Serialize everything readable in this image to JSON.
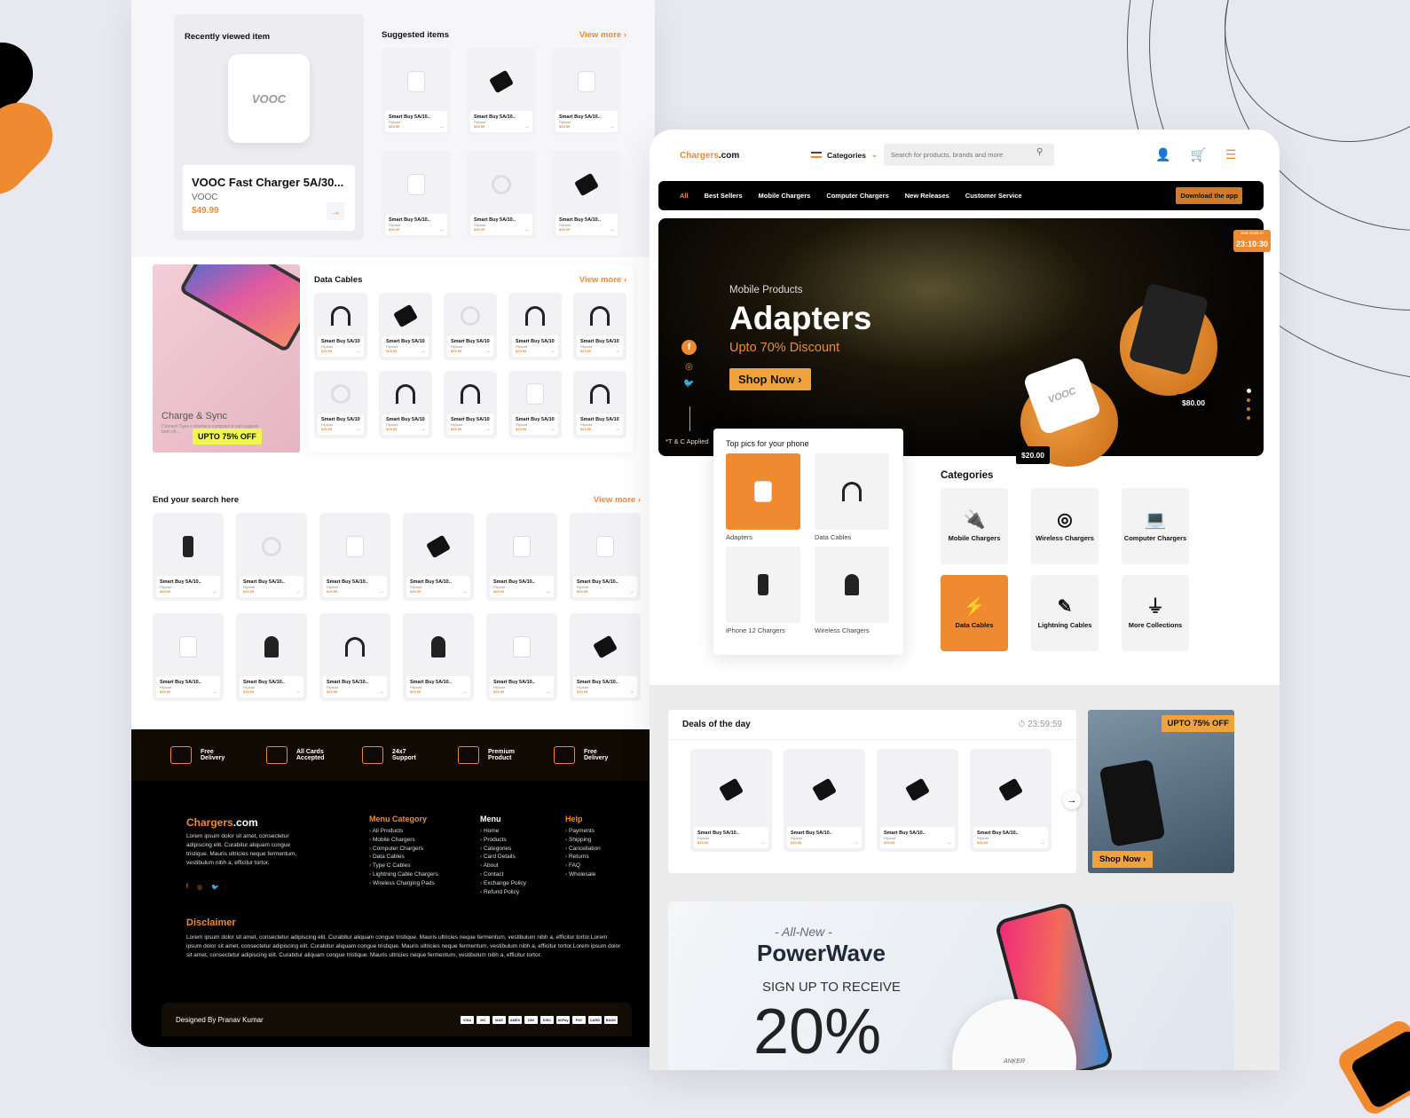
{
  "left_page": {
    "recent": {
      "heading": "Recently viewed item",
      "image_label": "VOOC",
      "product_name": "VOOC Fast Charger 5A/30...",
      "brand": "VOOC",
      "price": "$49.99",
      "arrow": "→"
    },
    "suggested": {
      "heading": "Suggested items",
      "view_more": "View more ›",
      "items": [
        {
          "name": "Smart Buy 5A/10..",
          "store": "Flipkart",
          "price": "$29.99",
          "shape": "charger-w"
        },
        {
          "name": "Smart Buy 5A/10..",
          "store": "Flipkart",
          "price": "$29.99",
          "shape": "charger-b"
        },
        {
          "name": "Smart Buy 5A/10..",
          "store": "Flipkart",
          "price": "$29.99",
          "shape": "charger-w"
        },
        {
          "name": "Smart Buy 5A/10..",
          "store": "Flipkart",
          "price": "$29.99",
          "shape": "charger-w"
        },
        {
          "name": "Smart Buy 5A/10..",
          "store": "Flipkart",
          "price": "$29.99",
          "shape": "coil"
        },
        {
          "name": "Smart Buy 5A/10..",
          "store": "Flipkart",
          "price": "$29.99",
          "shape": "charger-b"
        }
      ]
    },
    "promo_pink": {
      "title": "Charge & Sync",
      "desc": "Connect Type-c interface computer,it can support both ch...",
      "badge": "UPTO 75% OFF"
    },
    "data_cables": {
      "heading": "Data Cables",
      "view_more": "View more ›",
      "items": [
        {
          "name": "Smart Buy 5A/10..",
          "store": "Flipkart",
          "price": "$29.99",
          "shape": "cable"
        },
        {
          "name": "Smart Buy 5A/10..",
          "store": "Flipkart",
          "price": "$29.99",
          "shape": "charger-b"
        },
        {
          "name": "Smart Buy 5A/10..",
          "store": "Flipkart",
          "price": "$29.99",
          "shape": "coil"
        },
        {
          "name": "Smart Buy 5A/10..",
          "store": "Flipkart",
          "price": "$29.99",
          "shape": "cable"
        },
        {
          "name": "Smart Buy 5A/10..",
          "store": "Flipkart",
          "price": "$29.99",
          "shape": "cable"
        },
        {
          "name": "Smart Buy 5A/10..",
          "store": "Flipkart",
          "price": "$29.99",
          "shape": "coil"
        },
        {
          "name": "Smart Buy 5A/10..",
          "store": "Flipkart",
          "price": "$29.99",
          "shape": "cable"
        },
        {
          "name": "Smart Buy 5A/10..",
          "store": "Flipkart",
          "price": "$29.99",
          "shape": "cable"
        },
        {
          "name": "Smart Buy 5A/10..",
          "store": "Flipkart",
          "price": "$29.99",
          "shape": "charger-w"
        },
        {
          "name": "Smart Buy 5A/10..",
          "store": "Flipkart",
          "price": "$29.99",
          "shape": "cable"
        }
      ]
    },
    "end_search": {
      "heading": "End your search here",
      "view_more": "View more ›",
      "items": [
        {
          "name": "Smart Buy 5A/10..",
          "store": "Flipkart",
          "price": "$29.99",
          "shape": "phone"
        },
        {
          "name": "Smart Buy 5A/10..",
          "store": "Flipkart",
          "price": "$29.99",
          "shape": "coil"
        },
        {
          "name": "Smart Buy 5A/10..",
          "store": "Flipkart",
          "price": "$29.99",
          "shape": "charger-w"
        },
        {
          "name": "Smart Buy 5A/10..",
          "store": "Flipkart",
          "price": "$29.99",
          "shape": "charger-b"
        },
        {
          "name": "Smart Buy 5A/10..",
          "store": "Flipkart",
          "price": "$29.99",
          "shape": "charger-w"
        },
        {
          "name": "Smart Buy 5A/10..",
          "store": "Flipkart",
          "price": "$29.99",
          "shape": "charger-w"
        },
        {
          "name": "Smart Buy 5A/10..",
          "store": "Flipkart",
          "price": "$29.99",
          "shape": "charger-w"
        },
        {
          "name": "Smart Buy 5A/10..",
          "store": "Flipkart",
          "price": "$29.99",
          "shape": "stand"
        },
        {
          "name": "Smart Buy 5A/10..",
          "store": "Flipkart",
          "price": "$29.99",
          "shape": "cable"
        },
        {
          "name": "Smart Buy 5A/10..",
          "store": "Flipkart",
          "price": "$29.99",
          "shape": "stand"
        },
        {
          "name": "Smart Buy 5A/10..",
          "store": "Flipkart",
          "price": "$29.99",
          "shape": "charger-w"
        },
        {
          "name": "Smart Buy 5A/10..",
          "store": "Flipkart",
          "price": "$29.99",
          "shape": "charger-b"
        }
      ]
    },
    "features": [
      {
        "label": "Free Delivery",
        "icon": "truck-icon"
      },
      {
        "label": "All Cards Accepted",
        "icon": "credit-card-icon"
      },
      {
        "label": "24x7 Support",
        "icon": "support-agent-icon"
      },
      {
        "label": "Premium Product",
        "icon": "diamond-icon"
      },
      {
        "label": "Free Delivery",
        "icon": "truck-icon"
      }
    ],
    "footer": {
      "brand_main": "Chargers",
      "brand_suffix": ".com",
      "desc": "Lorem ipsum dolor sit amet, consectetur adipiscing elit. Curabitur aliquam congue tristique. Mauris ultricies neque fermentum, vestibulum nibh a, efficitur tortor.",
      "social": [
        "f",
        "◎",
        "🐦"
      ],
      "columns": [
        {
          "title": "Menu Category",
          "orange": true,
          "items": [
            "All Products",
            "Mobile Chargers",
            "Computer Chargers",
            "Data Cables",
            "Type C Cables",
            "Lightning Cable Chargers",
            "Wireless Charging Pads"
          ]
        },
        {
          "title": "Menu",
          "orange": false,
          "items": [
            "Home",
            "Products",
            "Categories",
            "Card Details",
            "About",
            "Contact",
            "Exchange Policy",
            "Refund Policy"
          ]
        },
        {
          "title": "Help",
          "orange": true,
          "items": [
            "Payments",
            "Shipping",
            "Cancellation",
            "Returns",
            "FAQ",
            "Wholesale"
          ]
        }
      ],
      "disclaimer_heading": "Disclaimer",
      "disclaimer_text": "Lorem ipsum dolor sit amet, consectetur adipiscing elit. Curabitur aliquam congue tristique. Mauris ultricies neque fermentum, vestibulum nibh a, efficitur tortor.Lorem ipsum dolor sit amet, consectetur adipiscing elit. Curabitur aliquam congue tristique. Mauris ultricies neque fermentum, vestibulum nibh a, efficitur tortor.Lorem ipsum dolor sit amet, consectetur adipiscing elit. Curabitur aliquam congue tristique. Mauris ultricies neque fermentum, vestibulum nibh a, efficitur tortor.",
      "designed_by": "Designed By Pranav Kumar",
      "payment_methods": [
        "VISA",
        "MC",
        "MAE",
        "AMEX",
        "DIN",
        "DISC",
        "AliPay",
        "PAY",
        "CARD",
        "BANK"
      ]
    }
  },
  "right_page": {
    "header": {
      "logo_main": "Chargers",
      "logo_suffix": ".com",
      "categories_label": "Categories",
      "search_placeholder": "Search for products, brands and more"
    },
    "nav": {
      "items": [
        "All",
        "Best Sellers",
        "Mobile Chargers",
        "Computer Chargers",
        "New Releases",
        "Customer Service"
      ],
      "download_label": "Download the app"
    },
    "hero": {
      "subtitle": "Mobile Products",
      "title": "Adapters",
      "discount": "Upto 70% Discount",
      "shop_label": "Shop Now  ›",
      "terms": "*T & C Applied",
      "sale_label": "Sale Ends In",
      "sale_timer": "23:10:30",
      "price_1": "$80.00",
      "price_2": "$20.00",
      "charger_brand": "VOOC",
      "slide_count": 4,
      "active_slide": 1
    },
    "top_picks": {
      "heading": "Top pics for your phone",
      "items": [
        {
          "label": "Adapters",
          "selected": true,
          "shape": "charger-w"
        },
        {
          "label": "Data Cables",
          "selected": false,
          "shape": "cable"
        },
        {
          "label": "iPhone 12 Chargers",
          "selected": false,
          "shape": "phone"
        },
        {
          "label": "Wireless Chargers",
          "selected": false,
          "shape": "stand"
        }
      ]
    },
    "categories": {
      "heading": "Categories",
      "items": [
        {
          "label": "Mobile Chargers",
          "icon": "🔌",
          "selected": false
        },
        {
          "label": "Wireless Chargers",
          "icon": "◎",
          "selected": false
        },
        {
          "label": "Computer Chargers",
          "icon": "💻",
          "selected": false
        },
        {
          "label": "Data Cables",
          "icon": "⚡",
          "selected": true
        },
        {
          "label": "Lightning Cables",
          "icon": "✎",
          "selected": false
        },
        {
          "label": "More Collections",
          "icon": "⏚",
          "selected": false
        }
      ]
    },
    "deals": {
      "heading": "Deals of the day",
      "timer": "23:59:59",
      "items": [
        {
          "name": "Smart Buy 5A/10..",
          "store": "Flipkart",
          "price": "$29.99",
          "shape": "charger-b"
        },
        {
          "name": "Smart Buy 5A/10..",
          "store": "Flipkart",
          "price": "$29.99",
          "shape": "charger-b"
        },
        {
          "name": "Smart Buy 5A/10..",
          "store": "Flipkart",
          "price": "$29.99",
          "shape": "charger-b"
        },
        {
          "name": "Smart Buy 5A/10..",
          "store": "Flipkart",
          "price": "$29.99",
          "shape": "charger-b"
        }
      ],
      "promo_badge": "UPTO 75% OFF",
      "promo_shop": "Shop Now  ›"
    },
    "powerwave": {
      "tagline": "- All-New -",
      "title": "PowerWave",
      "signup": "SIGN UP TO RECEIVE",
      "big": "20%",
      "pad_brand": "ANKER"
    }
  },
  "colors": {
    "accent": "#f08a30",
    "dark": "#000000",
    "background": "#e8e8f1"
  }
}
